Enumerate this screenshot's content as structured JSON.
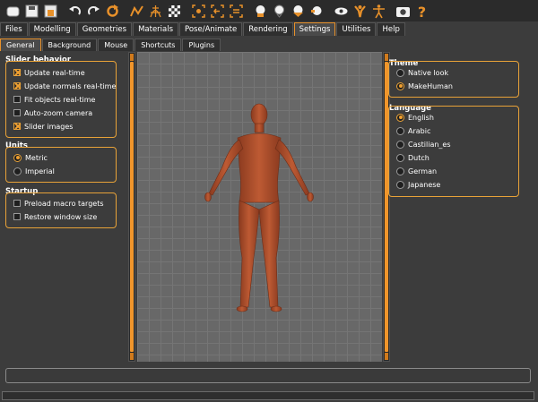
{
  "toolbar": {
    "icons": [
      "new-file-icon",
      "save-icon",
      "export-icon",
      "undo-icon",
      "redo-icon",
      "reset-icon",
      "smooth-icon",
      "wireframe-icon",
      "background-icon",
      "front-view-icon",
      "back-view-icon",
      "side-view-icon",
      "left-view-icon",
      "right-view-icon",
      "top-view-icon",
      "bottom-view-icon",
      "pose-icon",
      "skeleton-icon",
      "screenshot-icon",
      "help-icon"
    ]
  },
  "main_tabs": [
    {
      "label": "Files",
      "active": false
    },
    {
      "label": "Modelling",
      "active": false
    },
    {
      "label": "Geometries",
      "active": false
    },
    {
      "label": "Materials",
      "active": false
    },
    {
      "label": "Pose/Animate",
      "active": false
    },
    {
      "label": "Rendering",
      "active": false
    },
    {
      "label": "Settings",
      "active": true
    },
    {
      "label": "Utilities",
      "active": false
    },
    {
      "label": "Help",
      "active": false
    }
  ],
  "sub_tabs": [
    {
      "label": "General",
      "active": true
    },
    {
      "label": "Background",
      "active": false
    },
    {
      "label": "Mouse",
      "active": false
    },
    {
      "label": "Shortcuts",
      "active": false
    },
    {
      "label": "Plugins",
      "active": false
    }
  ],
  "slider_behavior": {
    "title": "Slider behavior",
    "items": [
      {
        "label": "Update real-time",
        "checked": true
      },
      {
        "label": "Update normals real-time",
        "checked": true
      },
      {
        "label": "Fit objects real-time",
        "checked": false
      },
      {
        "label": "Auto-zoom camera",
        "checked": false
      },
      {
        "label": "Slider images",
        "checked": true
      }
    ]
  },
  "units": {
    "title": "Units",
    "items": [
      {
        "label": "Metric",
        "selected": true
      },
      {
        "label": "Imperial",
        "selected": false
      }
    ]
  },
  "startup": {
    "title": "Startup",
    "items": [
      {
        "label": "Preload macro targets",
        "checked": false
      },
      {
        "label": "Restore window size",
        "checked": false
      }
    ]
  },
  "theme": {
    "title": "Theme",
    "items": [
      {
        "label": "Native look",
        "selected": false
      },
      {
        "label": "MakeHuman",
        "selected": true
      }
    ]
  },
  "language": {
    "title": "Language",
    "items": [
      {
        "label": "English",
        "selected": true
      },
      {
        "label": "Arabic",
        "selected": false
      },
      {
        "label": "Castilian_es",
        "selected": false
      },
      {
        "label": "Dutch",
        "selected": false
      },
      {
        "label": "German",
        "selected": false
      },
      {
        "label": "Japanese",
        "selected": false
      }
    ]
  },
  "colors": {
    "accent": "#e8a238",
    "skin": "#b4532f",
    "viewport_bg": "#686868"
  }
}
